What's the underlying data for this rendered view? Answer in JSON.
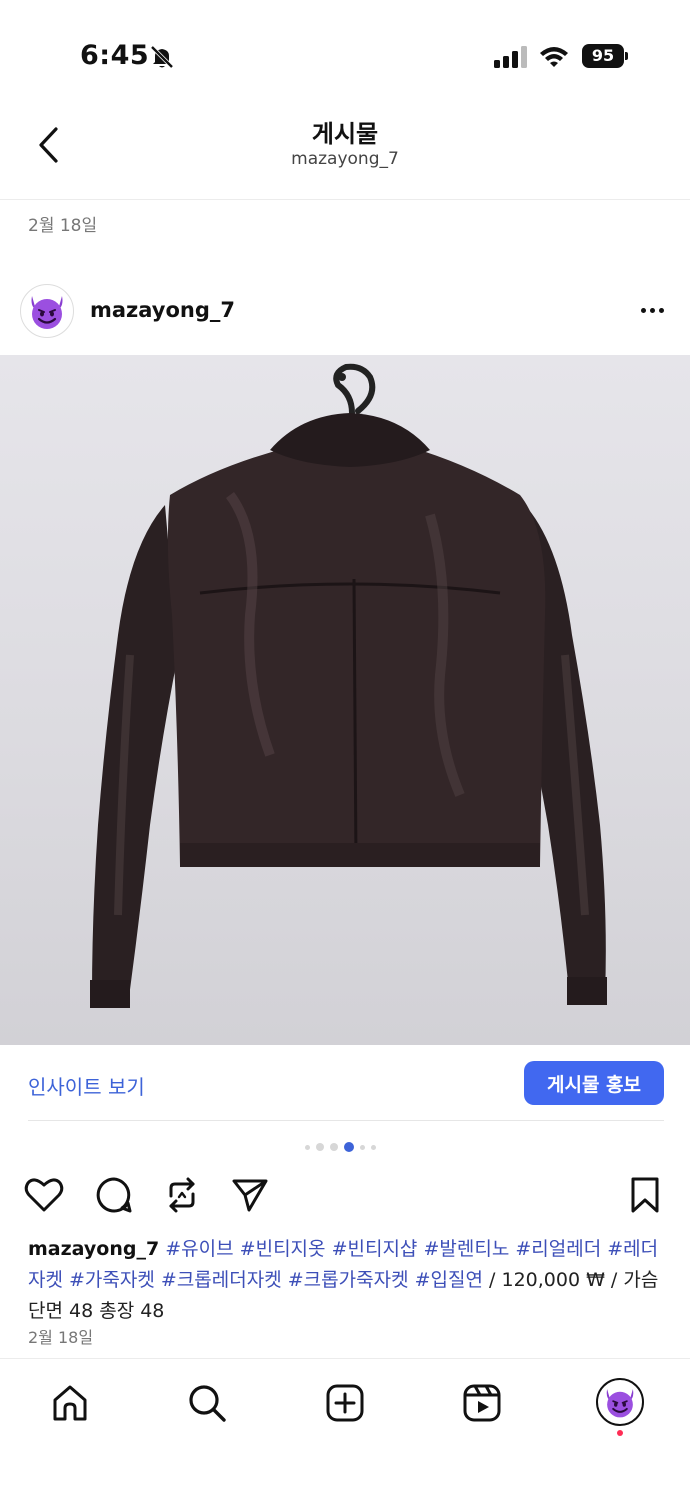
{
  "status": {
    "time": "6:45",
    "battery": "95",
    "icons": [
      "bell-off-icon",
      "signal-icon",
      "wifi-icon",
      "battery-icon"
    ]
  },
  "header": {
    "title": "게시물",
    "subtitle": "mazayong_7",
    "back_icon": "chevron-left-icon"
  },
  "post": {
    "date_top": "2월 18일",
    "author": "mazayong_7",
    "avatar_icon": "smiling-devil-emoji",
    "more_icon": "more-horizontal-icon",
    "photo_description": "black leather cropped jacket on hanger, back view",
    "insights_label": "인사이트 보기",
    "promote_label": "게시물 홍보",
    "carousel": {
      "total": 6,
      "active": 4
    },
    "actions": [
      "heart-icon",
      "comment-icon",
      "repost-icon",
      "share-icon",
      "bookmark-icon"
    ],
    "caption": {
      "username": "mazayong_7",
      "tags": [
        "#유이브",
        "#빈티지옷",
        "#빈티지샵",
        "#발렌티노",
        "#리얼레더",
        "#레더자켓",
        "#가죽자켓",
        "#크롭레더자켓",
        "#크롭가죽자켓",
        "#입질연"
      ],
      "tail": "/ 120,000 ₩ / 가슴단면 48 총장 48"
    },
    "date_bottom": "2월 18일"
  },
  "nav": {
    "items": [
      "home-icon",
      "search-icon",
      "create-icon",
      "reels-icon",
      "profile-avatar"
    ]
  },
  "colors": {
    "accent": "#4168f0",
    "link": "#3d63d8",
    "hashtag": "#3d4fb8",
    "notification_dot": "#ff2d55"
  }
}
